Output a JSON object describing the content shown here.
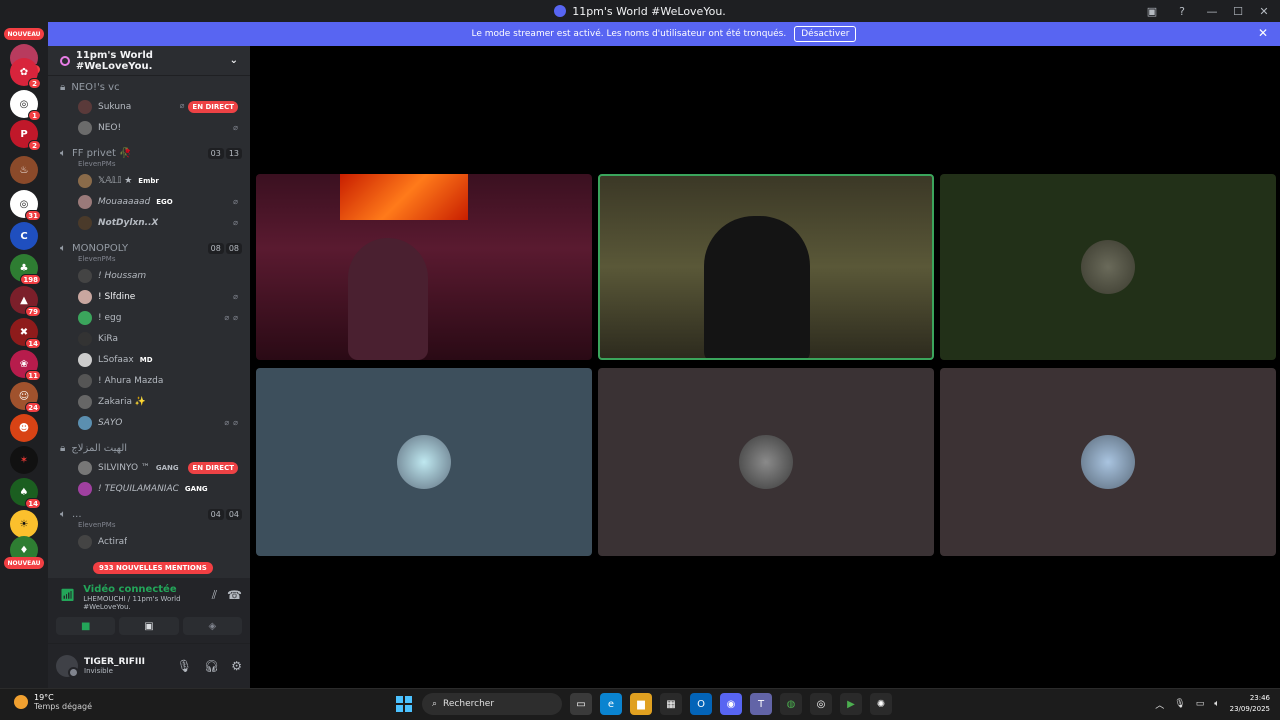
{
  "window": {
    "title": "11pm's World #WeLoveYou."
  },
  "banner": {
    "text": "Le mode streamer est activé. Les noms d'utilisateur ont été tronqués.",
    "button": "Désactiver"
  },
  "rail": {
    "top_pill": "NOUVEAU",
    "bottom_pill": "NOUVEAU",
    "badges": [
      "3",
      "2",
      "1",
      "2",
      "31",
      "198",
      "79",
      "14",
      "11",
      "24",
      "14"
    ]
  },
  "server": {
    "name": "11pm's World #WeLoveYou."
  },
  "channels": {
    "neo_vc": {
      "name": "NEO!'s vc",
      "users": [
        {
          "name": "Sukuna",
          "status": "EN DIRECT"
        },
        {
          "name": "NEO!"
        }
      ]
    },
    "ff_privet": {
      "name": "FF privet 🥀",
      "sub": "ElevenPMs",
      "count_a": "03",
      "count_b": "13",
      "users": [
        {
          "name": "𝕏𝔸𝕃𝕀 ★",
          "tag": "Embr"
        },
        {
          "name": "Mouaaaaad",
          "tag": "EGO"
        },
        {
          "name": "NotDylxn..X"
        }
      ]
    },
    "monopoly": {
      "name": "MONOPOLY",
      "sub": "ElevenPMs",
      "count_a": "08",
      "count_b": "08",
      "users": [
        {
          "name": "! Houssam"
        },
        {
          "name": "! Slfdine"
        },
        {
          "name": "! egg"
        },
        {
          "name": "KiRa"
        },
        {
          "name": "LSofaax",
          "tag": "MD"
        },
        {
          "name": "! Ahura Mazda"
        },
        {
          "name": "Zakaria ✨"
        },
        {
          "name": "SAYO"
        }
      ]
    },
    "locked": {
      "name": "الهيت المزلاج",
      "users": [
        {
          "name": "SILVINYO ™",
          "tag": "GANG",
          "status": "EN DIRECT"
        },
        {
          "name": "! TEQUILAMANIAC",
          "tag": "GANG"
        }
      ]
    },
    "last": {
      "name": "...",
      "sub": "ElevenPMs",
      "count_a": "04",
      "count_b": "04",
      "users": [
        {
          "name": "Actiraf"
        }
      ]
    },
    "mentions": "933 NOUVELLES MENTIONS"
  },
  "voice": {
    "status": "Vidéo connectée",
    "location": "LHEMOUCHI / 11pm's World #WeLoveYou."
  },
  "user": {
    "name": "TIGER_RIFIII",
    "status": "Invisible"
  },
  "taskbar": {
    "temp": "19°C",
    "weather": "Temps dégagé",
    "search": "Rechercher",
    "time": "23:46",
    "date": "23/09/2025"
  },
  "colors": {
    "accent": "#5865f2",
    "live": "#ed4245",
    "connected": "#23a559",
    "speaking_border": "#3ba55c"
  }
}
